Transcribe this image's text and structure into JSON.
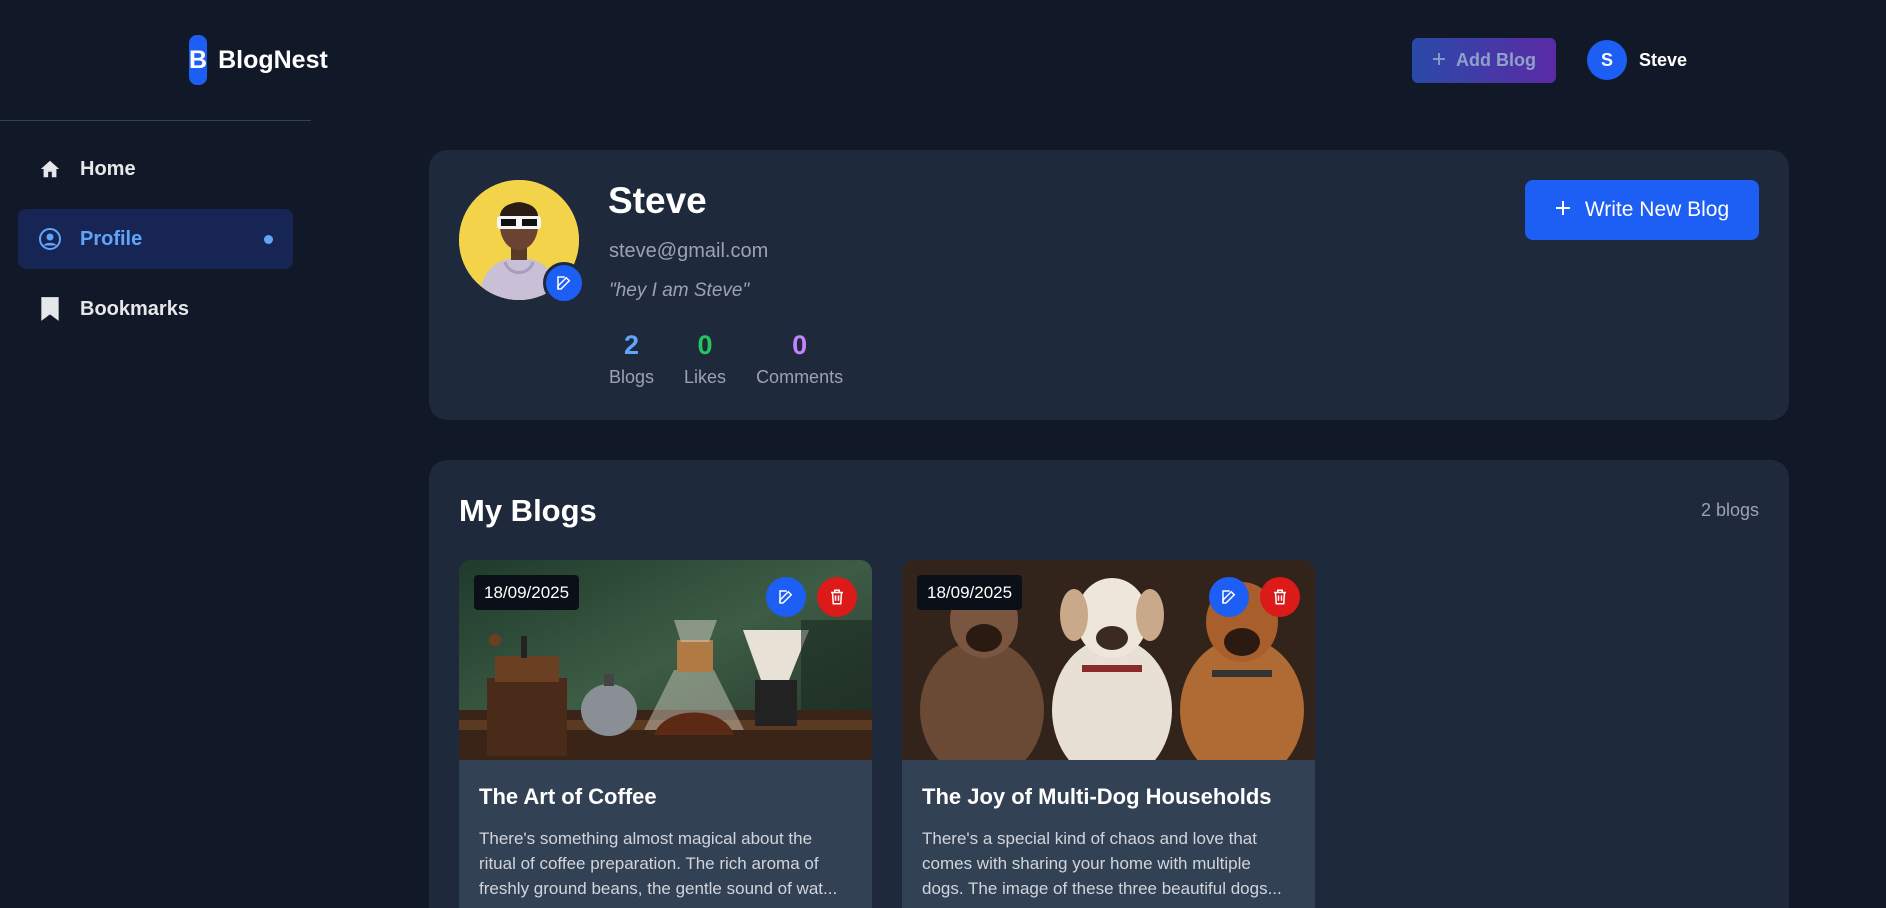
{
  "brand": {
    "logo_letter": "B",
    "name": "BlogNest"
  },
  "sidebar": {
    "items": [
      {
        "label": "Home",
        "icon": "home-icon",
        "active": false
      },
      {
        "label": "Profile",
        "icon": "user-circle-icon",
        "active": true
      },
      {
        "label": "Bookmarks",
        "icon": "bookmark-icon",
        "active": false
      }
    ]
  },
  "topbar": {
    "add_blog_label": "Add Blog",
    "user_initial": "S",
    "user_name": "Steve"
  },
  "profile": {
    "name": "Steve",
    "email": "steve@gmail.com",
    "bio": "\"hey I am Steve\"",
    "write_button_label": "Write New Blog",
    "stats": [
      {
        "value": "2",
        "label": "Blogs",
        "color": "#60a5fa"
      },
      {
        "value": "0",
        "label": "Likes",
        "color": "#22c55e"
      },
      {
        "value": "0",
        "label": "Comments",
        "color": "#c084fc"
      }
    ]
  },
  "blogs_section": {
    "title": "My Blogs",
    "count_label": "2 blogs",
    "blogs": [
      {
        "date": "18/09/2025",
        "title": "The Art of Coffee",
        "excerpt": "There's something almost magical about the ritual of coffee preparation. The rich aroma of freshly ground beans, the gentle sound of wat..."
      },
      {
        "date": "18/09/2025",
        "title": "The Joy of Multi-Dog Households",
        "excerpt": "There's a special kind of chaos and love that comes with sharing your home with multiple dogs. The image of these three beautiful dogs..."
      }
    ]
  },
  "colors": {
    "accent": "#1d5ef5",
    "danger": "#dc1a1a",
    "background": "#111827",
    "card": "#1e293b"
  }
}
